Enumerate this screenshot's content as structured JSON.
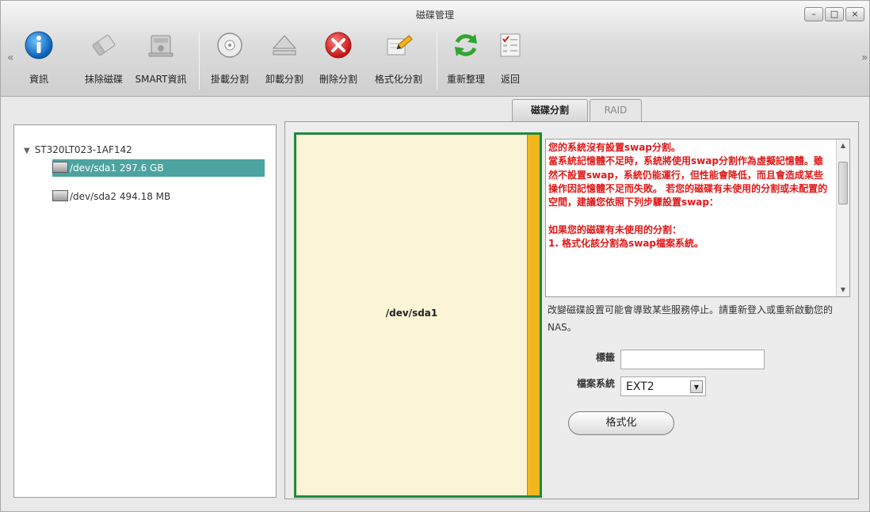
{
  "window": {
    "title": "磁碟管理",
    "controls": {
      "minimize": "–",
      "maximize": "□",
      "close": "×"
    }
  },
  "toolbar": {
    "nav_left": "«",
    "nav_right": "»",
    "items": [
      {
        "label": "資訊",
        "icon": "info-icon"
      },
      {
        "label": "抹除磁碟",
        "icon": "eraser-icon"
      },
      {
        "label": "SMART資訊",
        "icon": "disk-health-icon"
      },
      {
        "label": "掛載分割",
        "icon": "mount-disk-icon"
      },
      {
        "label": "卸載分割",
        "icon": "eject-icon"
      },
      {
        "label": "刪除分割",
        "icon": "delete-icon"
      },
      {
        "label": "格式化分割",
        "icon": "format-pencil-icon"
      },
      {
        "label": "重新整理",
        "icon": "refresh-icon"
      },
      {
        "label": "返回",
        "icon": "checklist-icon"
      }
    ]
  },
  "tabs": {
    "partition": "磁碟分割",
    "raid": "RAID"
  },
  "tree": {
    "disk": "ST320LT023-1AF142",
    "partitions": [
      {
        "name": "/dev/sda1 297.6 GB",
        "selected": true
      },
      {
        "name": "/dev/sda2 494.18 MB",
        "selected": false
      }
    ]
  },
  "volume": {
    "label": "/dev/sda1"
  },
  "warning": {
    "text": "您的系統沒有設置swap分割。\n當系統記憶體不足時，系統將使用swap分割作為虛擬記憶體。雖然不設置swap，系統仍能運行，但性能會降低，而且會造成某些操作因記憶體不足而失敗。 若您的磁碟有未使用的分割或未配置的空間，建議您依照下列步驟設置swap：\n\n如果您的磁碟有未使用的分割：\n1. 格式化該分割為swap檔案系統。"
  },
  "note": "改變磁碟設置可能會導致某些服務停止。請重新登入或重新啟動您的NAS。",
  "form": {
    "tag_label": "標籤",
    "tag_value": "",
    "fs_label": "檔案系統",
    "fs_value": "EXT2",
    "format_button": "格式化"
  },
  "colors": {
    "volume_border": "#1e8a3c",
    "volume_fill": "#fbf4d6",
    "volume_bar": "#f1b71c",
    "selection": "#4ca3a0",
    "warning_text": "#e01818"
  }
}
